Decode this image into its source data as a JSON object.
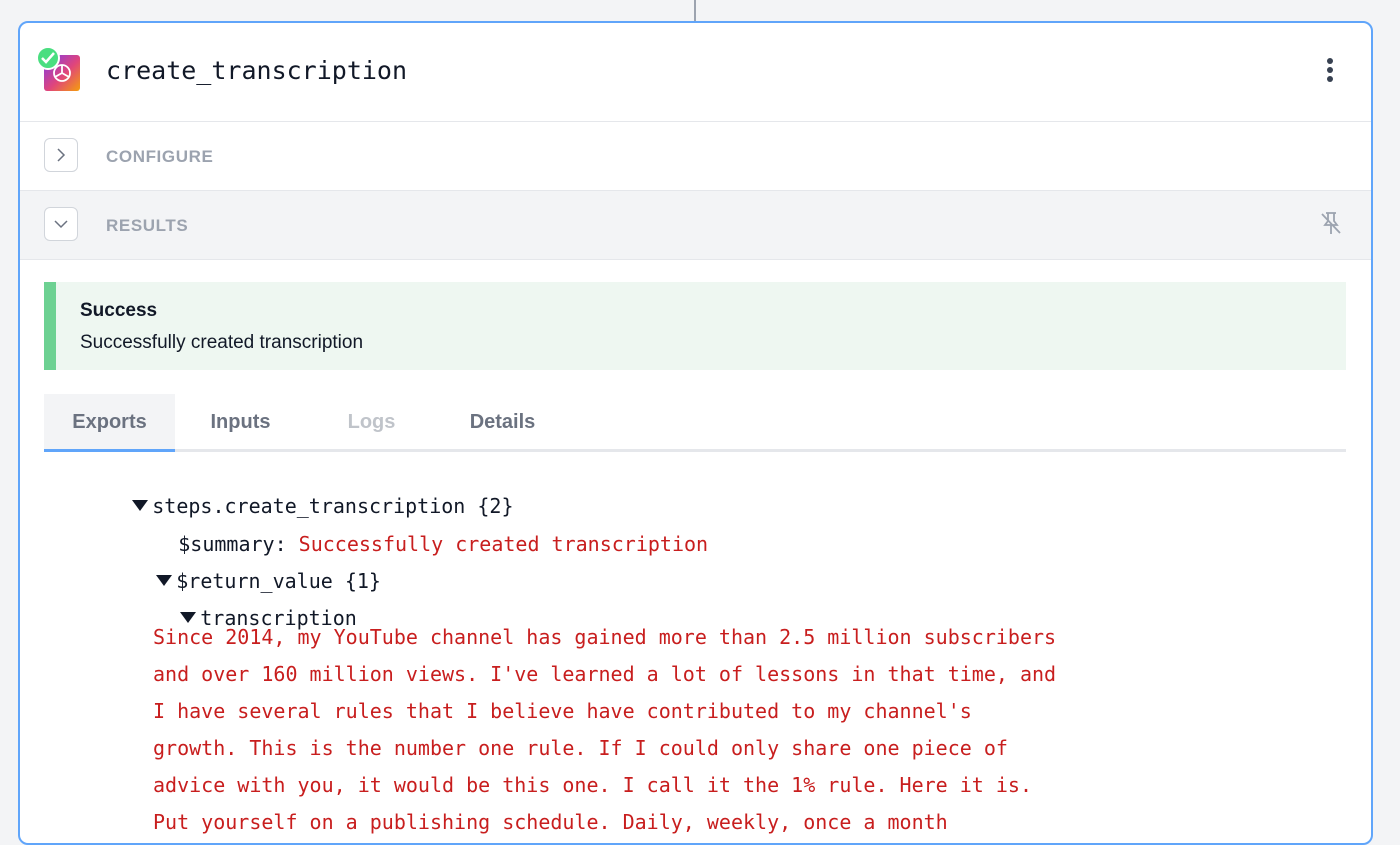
{
  "step": {
    "title": "create_transcription"
  },
  "sections": {
    "configure": "CONFIGURE",
    "results": "RESULTS"
  },
  "alert": {
    "title": "Success",
    "message": "Successfully created transcription"
  },
  "tabs": [
    "Exports",
    "Inputs",
    "Logs",
    "Details"
  ],
  "tree": {
    "root_key": "steps.create_transcription",
    "root_count": "{2}",
    "summary_key": "$summary:",
    "summary_value": "Successfully created transcription",
    "return_key": "$return_value",
    "return_count": "{1}",
    "transcription_key": "transcription",
    "transcription_lines": [
      "Since 2014, my YouTube channel has gained more than 2.5 million subscribers",
      "and over 160 million views. I've learned a lot of lessons in that time, and",
      "I have several rules that I believe have contributed to my channel's",
      "growth. This is the number one rule. If I could only share one piece of",
      "advice with you, it would be this one. I call it the 1% rule. Here it is.",
      "Put yourself on a publishing schedule. Daily, weekly, once a month"
    ]
  },
  "colors": {
    "accent": "#60a5fa",
    "success": "#6dd192",
    "string": "#c81e1e"
  }
}
